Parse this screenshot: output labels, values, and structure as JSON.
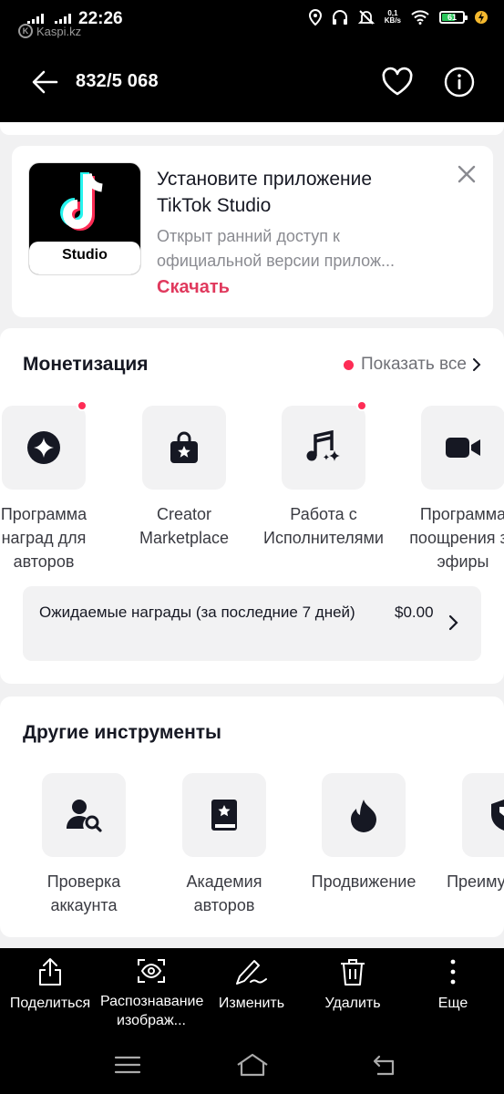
{
  "status_bar": {
    "time": "22:26",
    "watermark": "Kaspi.kz",
    "watermark_initial": "K",
    "net_speed_value": "0,1",
    "net_speed_unit": "KB/s",
    "battery_level": "61"
  },
  "header": {
    "counter": "832/5 068"
  },
  "promo": {
    "app_name": "Studio",
    "title": "Установите приложение TikTok Studio",
    "description": "Открыт ранний доступ к официальной версии прилож...",
    "cta": "Скачать"
  },
  "monetization": {
    "title": "Монетизация",
    "show_all": "Показать все",
    "tools": [
      {
        "label": "Программа наград для авторов",
        "icon": "sparkle-star-icon",
        "has_dot": true
      },
      {
        "label": "Creator Marketplace",
        "icon": "shopping-bag-star-icon",
        "has_dot": false
      },
      {
        "label": "Работа с Исполнителями",
        "icon": "music-note-sparkle-icon",
        "has_dot": true
      },
      {
        "label": "Программа поощрения за эфиры",
        "icon": "video-camera-icon",
        "has_dot": false
      }
    ],
    "rewards": {
      "label": "Ожидаемые награды (за последние 7 дней)",
      "amount": "$0.00"
    }
  },
  "other_tools": {
    "title": "Другие инструменты",
    "tools": [
      {
        "label": "Проверка аккаунта",
        "icon": "user-search-icon"
      },
      {
        "label": "Академия авторов",
        "icon": "book-star-icon"
      },
      {
        "label": "Продвижение",
        "icon": "flame-icon"
      },
      {
        "label": "Преимущества",
        "icon": "shield-badge-icon"
      }
    ]
  },
  "actions": {
    "share": "Поделиться",
    "recognize": "Распознавание изображ...",
    "edit": "Изменить",
    "delete": "Удалить",
    "more": "Еще"
  },
  "colors": {
    "accent_red": "#fe2c55",
    "cta_pink": "#e0395d",
    "battery_green": "#29c45a",
    "dark_bg": "#000000"
  }
}
